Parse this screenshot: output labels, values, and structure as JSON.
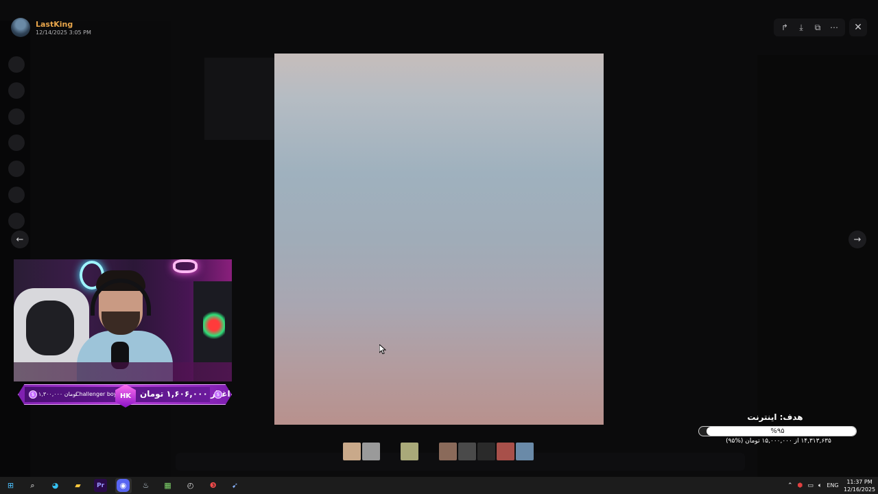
{
  "viewer": {
    "author_name": "LastKing",
    "author_date": "12/14/2025 3:05 PM",
    "toolbar": [
      {
        "name": "share-icon",
        "glyph": "↱"
      },
      {
        "name": "download-icon",
        "glyph": "⤓"
      },
      {
        "name": "open-external-icon",
        "glyph": "⧉"
      },
      {
        "name": "more-icon",
        "glyph": "⋯"
      }
    ],
    "close_glyph": "✕",
    "prev_glyph": "←",
    "next_glyph": "→"
  },
  "thumbnails": [
    {
      "color": "#c9a98a"
    },
    {
      "color": "#9a9a9a"
    },
    {
      "color": "#a9a979"
    },
    {
      "color": "#8a6a5a"
    },
    {
      "color": "#4a4a4a"
    },
    {
      "color": "#2a2a2a"
    },
    {
      "color": "#a8504a"
    },
    {
      "color": "#6a8aa8"
    }
  ],
  "stream_overlay": {
    "donation_left": "۱,۳۰۰,۰۰۰ تومان",
    "donor_name": "Challenger boy",
    "logo_text": "HK",
    "donation_right": "اغیار ۱,۶۰۶,۰۰۰ تومان",
    "coin_symbol": "$"
  },
  "goal": {
    "title": "هدف: اینترنت",
    "percent_label": "%۹۵",
    "progress": 0.95,
    "detail": "۱۴,۳۱۳,۶۳۵ از ۱۵,۰۰۰,۰۰۰ تومان (%۹۵)"
  },
  "taskbar": {
    "language": "ENG",
    "time": "11:37 PM",
    "date": "12/16/2025",
    "apps": [
      {
        "name": "windows-start-icon",
        "glyph": "⊞",
        "color": "#4cc2ff"
      },
      {
        "name": "search-icon",
        "glyph": "⌕",
        "color": "#ffffff"
      },
      {
        "name": "edge-icon",
        "glyph": "◕",
        "color": "#35c1f1"
      },
      {
        "name": "file-explorer-icon",
        "glyph": "▰",
        "color": "#ffc83d"
      },
      {
        "name": "premiere-pro-icon",
        "glyph": "Pr",
        "color": "#9999ff"
      },
      {
        "name": "discord-icon",
        "glyph": "◉",
        "color": "#ffffff"
      },
      {
        "name": "steam-icon",
        "glyph": "♨",
        "color": "#c7d5e0"
      },
      {
        "name": "store-icon",
        "glyph": "▦",
        "color": "#7fd66b"
      },
      {
        "name": "clock-app-icon",
        "glyph": "◴",
        "color": "#dddddd"
      },
      {
        "name": "app-red-icon",
        "glyph": "❸",
        "color": "#ff4d4d"
      },
      {
        "name": "app-arrow-icon",
        "glyph": "➹",
        "color": "#8ab4ff"
      }
    ]
  }
}
